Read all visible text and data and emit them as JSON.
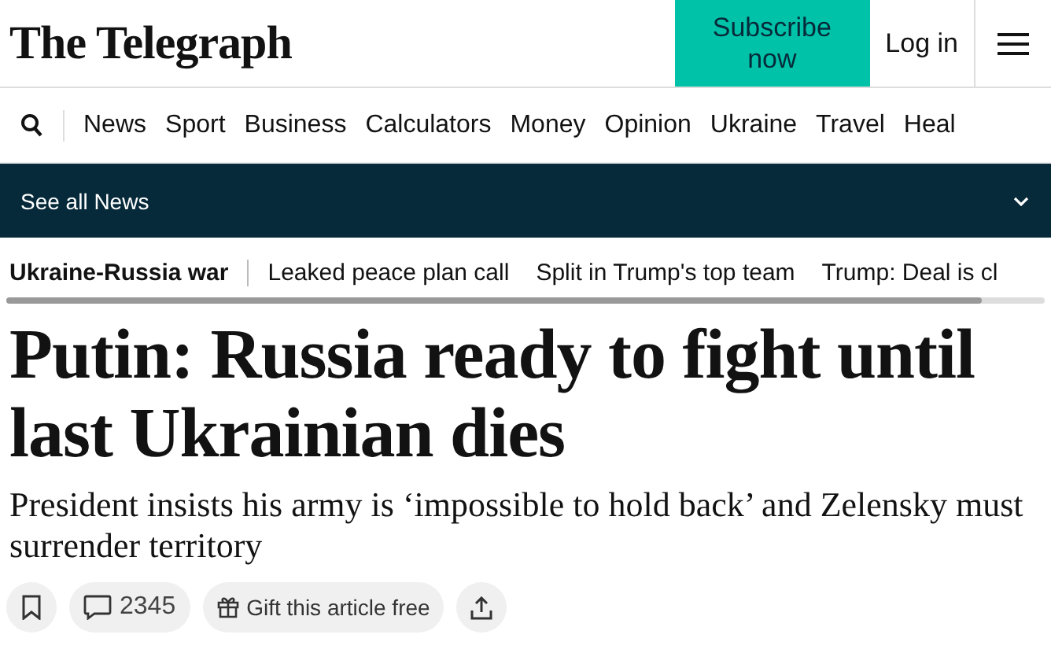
{
  "masthead": {
    "logo": "The Telegraph",
    "subscribe": "Subscribe now",
    "login": "Log in"
  },
  "nav": [
    "News",
    "Sport",
    "Business",
    "Calculators",
    "Money",
    "Opinion",
    "Ukraine",
    "Travel",
    "Heal"
  ],
  "section_bar": {
    "label": "See all News",
    "expanded": false
  },
  "topics": [
    {
      "label": "Ukraine-Russia war",
      "kind": "main"
    },
    {
      "label": "Leaked peace plan call",
      "kind": "link"
    },
    {
      "label": "Split in Trump's top team",
      "kind": "link"
    },
    {
      "label": "Trump: Deal is cl",
      "kind": "link"
    }
  ],
  "headline": "Putin: Russia ready to fight until last Ukrainian dies",
  "standfirst": "President insists his army is ‘impossible to hold back’ and Zelensky must surrender territory",
  "actions": {
    "comments": "2345",
    "gift": "Gift this article free"
  }
}
